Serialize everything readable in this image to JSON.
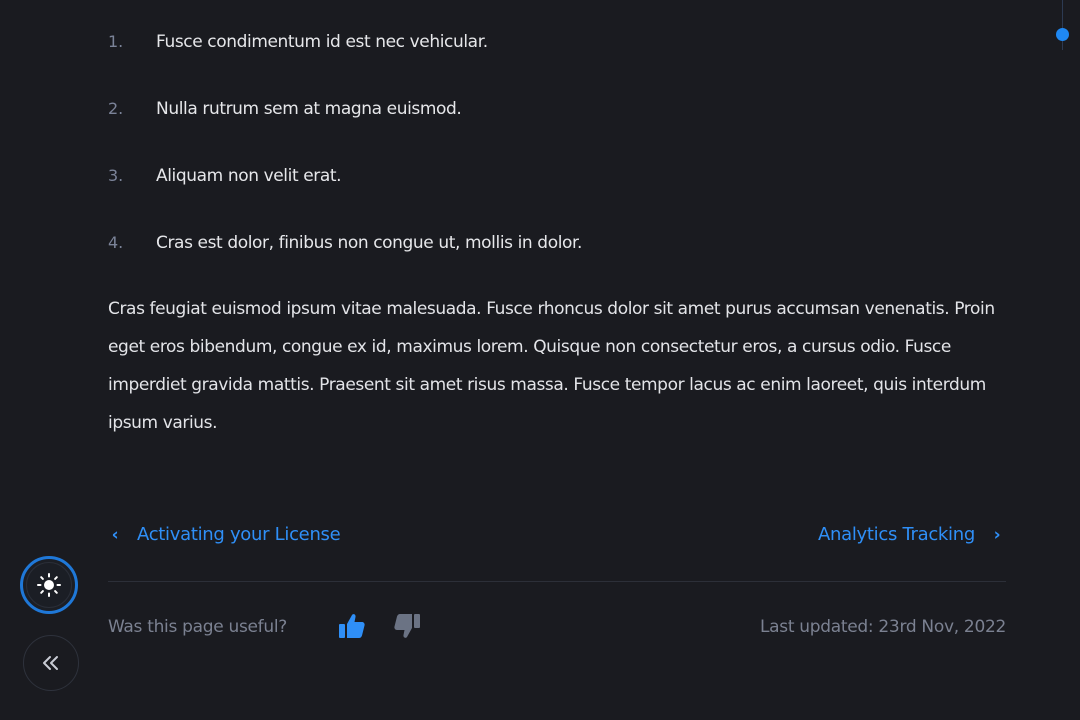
{
  "ordered_list": [
    {
      "number": "1.",
      "text": "Fusce condimentum id est nec vehicular."
    },
    {
      "number": "2.",
      "text": "Nulla rutrum sem at magna euismod."
    },
    {
      "number": "3.",
      "text": "Aliquam non velit erat."
    },
    {
      "number": "4.",
      "text": "Cras est dolor, finibus non congue ut, mollis in dolor."
    }
  ],
  "paragraph": "Cras feugiat euismod ipsum vitae malesuada. Fusce rhoncus dolor sit amet purus accumsan venenatis. Proin eget eros bibendum, congue ex id, maximus lorem. Quisque non consectetur eros, a cursus odio. Fusce imperdiet gravida mattis. Praesent sit amet risus massa. Fusce tempor lacus ac enim laoreet, quis interdum ipsum varius.",
  "pagination": {
    "prev_label": "Activating your License",
    "next_label": "Analytics Tracking",
    "prev_icon": "chevron-left-icon",
    "next_icon": "chevron-right-icon"
  },
  "feedback": {
    "question": "Was this page useful?",
    "up_icon": "thumbs-up-icon",
    "down_icon": "thumbs-down-icon"
  },
  "last_updated": "Last updated: 23rd Nov, 2022",
  "controls": {
    "theme_icon": "sun-icon",
    "collapse_icon": "double-chevron-left-icon"
  },
  "colors": {
    "background": "#1a1b20",
    "accent": "#2f8ff7",
    "thumb_up": "#2f8ff7",
    "thumb_down": "#6b7384",
    "muted_text": "#7b8191"
  }
}
